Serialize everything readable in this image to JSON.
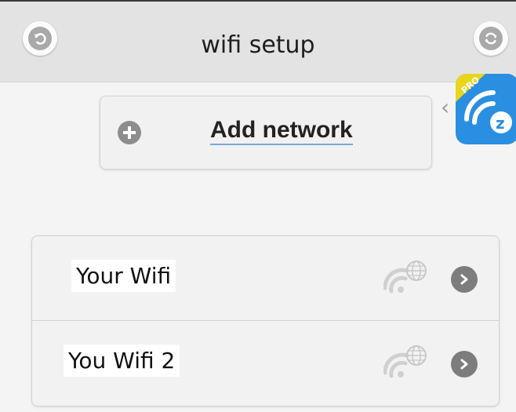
{
  "header": {
    "title": "wifi setup",
    "back_icon": "back-arrow-icon",
    "refresh_icon": "refresh-icon"
  },
  "add_network": {
    "label": "Add network",
    "icon": "plus-icon"
  },
  "promo": {
    "badge": "PRO",
    "logo_letter": "z"
  },
  "networks": [
    {
      "name": "Your Wifi",
      "signal_icon": "wifi-globe-icon",
      "action_icon": "chevron-right-icon"
    },
    {
      "name": "You Wifi 2",
      "signal_icon": "wifi-globe-icon",
      "action_icon": "chevron-right-icon"
    }
  ],
  "colors": {
    "header_bg": "#e3e3e3",
    "page_bg": "#f4f4f4",
    "icon_gray": "#8d8d8d",
    "promo_blue": "#2a8fe0",
    "promo_badge": "#e8d51c",
    "link_underline": "#7aa7d6"
  }
}
